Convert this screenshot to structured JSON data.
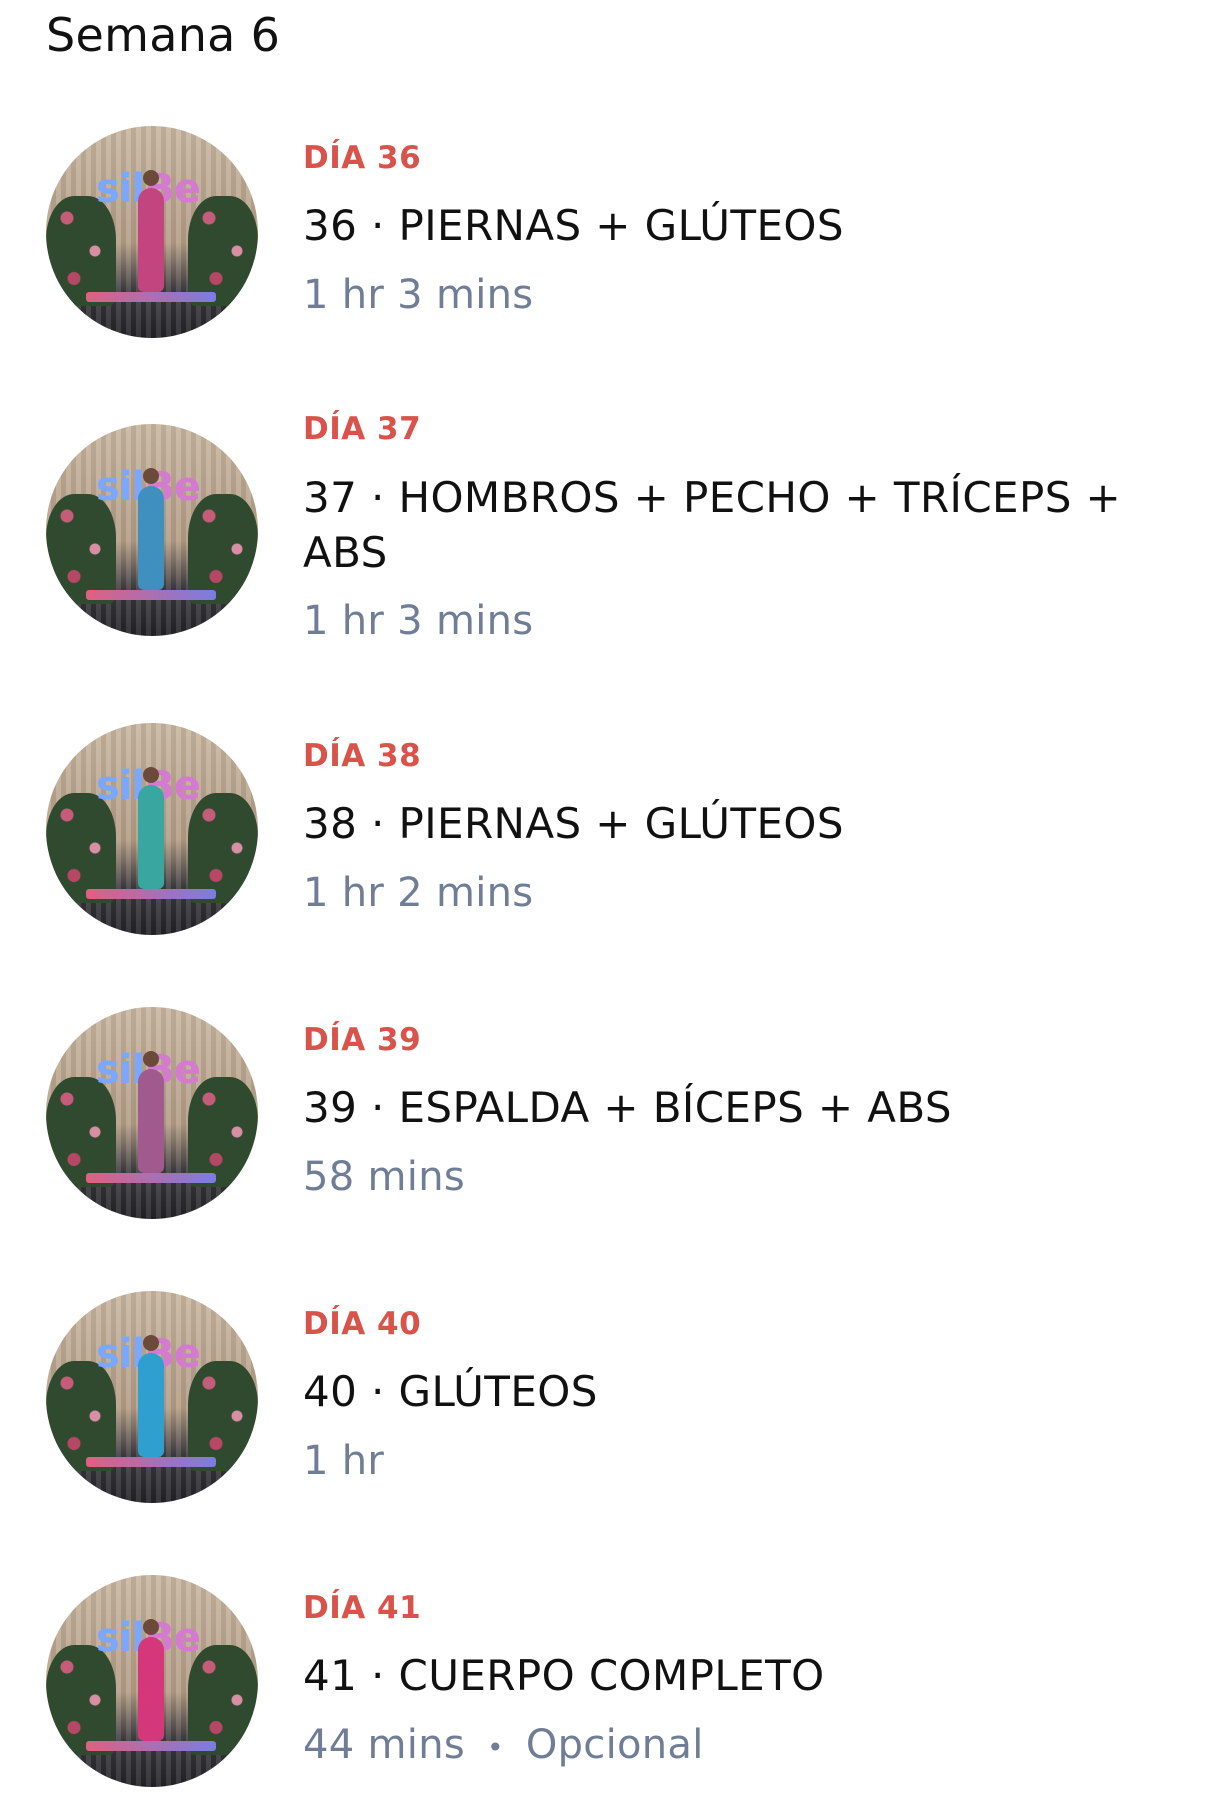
{
  "week": {
    "title": "Semana 6"
  },
  "workouts": [
    {
      "day_label": "DÍA 36",
      "title": "36 · PIERNAS + GLÚTEOS",
      "duration": "1 hr 3 mins",
      "tag": "",
      "outfit_color": "#c2457f"
    },
    {
      "day_label": "DÍA 37",
      "title": "37 · HOMBROS + PECHO + TRÍCEPS + ABS",
      "duration": "1 hr 3 mins",
      "tag": "",
      "outfit_color": "#3f8fbf"
    },
    {
      "day_label": "DÍA 38",
      "title": "38 · PIERNAS + GLÚTEOS",
      "duration": "1 hr 2 mins",
      "tag": "",
      "outfit_color": "#3aa6a0"
    },
    {
      "day_label": "DÍA 39",
      "title": "39 · ESPALDA + BÍCEPS + ABS",
      "duration": "58 mins",
      "tag": "",
      "outfit_color": "#a05a8e"
    },
    {
      "day_label": "DÍA 40",
      "title": "40 · GLÚTEOS",
      "duration": "1 hr",
      "tag": "",
      "outfit_color": "#2f9fd0"
    },
    {
      "day_label": "DÍA 41",
      "title": "41 · CUERPO COMPLETO",
      "duration": "44 mins",
      "tag": "Opcional",
      "outfit_color": "#d4387a"
    }
  ],
  "thumbnail": {
    "logo_part1": "sil",
    "logo_part2": "Be"
  },
  "colors": {
    "day_label": "#d9534a",
    "meta": "#6f7d96",
    "title": "#111111"
  }
}
